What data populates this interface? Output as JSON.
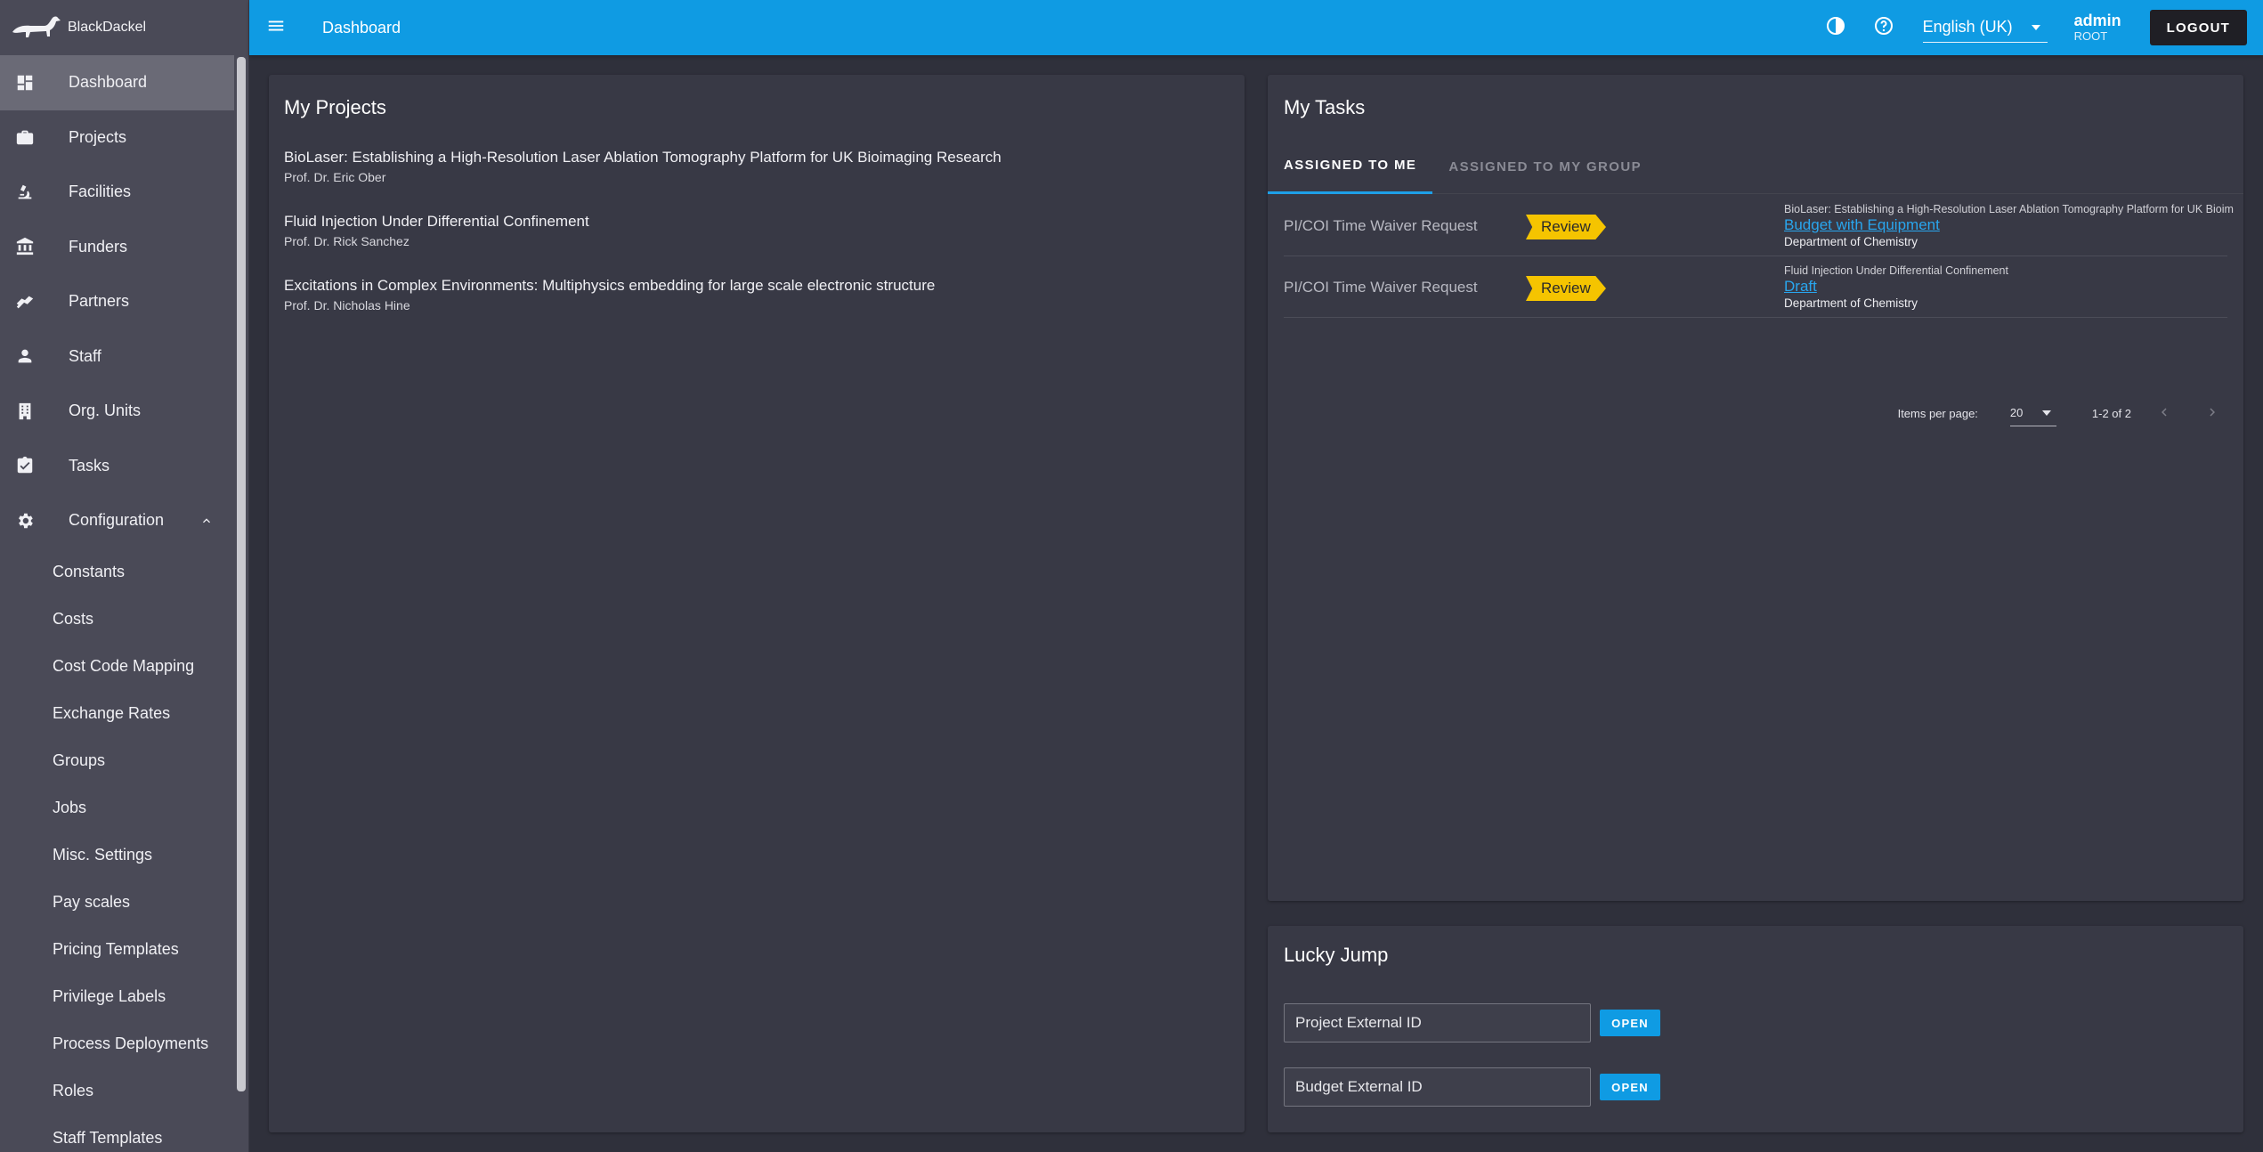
{
  "app": {
    "name": "BlackDackel"
  },
  "topbar": {
    "title": "Dashboard",
    "language": "English (UK)",
    "user_name": "admin",
    "user_role": "ROOT",
    "logout_label": "LOGOUT"
  },
  "sidebar": {
    "items": [
      {
        "label": "Dashboard",
        "icon": "dashboard-icon"
      },
      {
        "label": "Projects",
        "icon": "briefcase-icon"
      },
      {
        "label": "Facilities",
        "icon": "microscope-icon"
      },
      {
        "label": "Funders",
        "icon": "bank-icon"
      },
      {
        "label": "Partners",
        "icon": "handshake-icon"
      },
      {
        "label": "Staff",
        "icon": "person-icon"
      },
      {
        "label": "Org. Units",
        "icon": "building-icon"
      },
      {
        "label": "Tasks",
        "icon": "clipboard-check-icon"
      },
      {
        "label": "Configuration",
        "icon": "gear-icon"
      }
    ],
    "config_items": [
      "Constants",
      "Costs",
      "Cost Code Mapping",
      "Exchange Rates",
      "Groups",
      "Jobs",
      "Misc. Settings",
      "Pay scales",
      "Pricing Templates",
      "Privilege Labels",
      "Process Deployments",
      "Roles",
      "Staff Templates"
    ]
  },
  "projects": {
    "title": "My Projects",
    "items": [
      {
        "title": "BioLaser: Establishing a High-Resolution Laser Ablation Tomography Platform for UK Bioimaging Research",
        "pi": "Prof. Dr. Eric Ober"
      },
      {
        "title": "Fluid Injection Under Differential Confinement",
        "pi": "Prof. Dr. Rick Sanchez"
      },
      {
        "title": "Excitations in Complex Environments: Multiphysics embedding for large scale electronic structure",
        "pi": "Prof. Dr. Nicholas Hine"
      }
    ]
  },
  "tasks": {
    "title": "My Tasks",
    "tabs": [
      "ASSIGNED TO ME",
      "ASSIGNED TO MY GROUP"
    ],
    "rows": [
      {
        "name": "PI/COI Time Waiver Request",
        "status": "Review",
        "project": "BioLaser: Establishing a High-Resolution Laser Ablation Tomography Platform for UK Bioim",
        "link": "Budget with Equipment",
        "department": "Department of Chemistry"
      },
      {
        "name": "PI/COI Time Waiver Request",
        "status": "Review",
        "project": "Fluid Injection Under Differential Confinement",
        "link": "Draft",
        "department": "Department of Chemistry"
      }
    ],
    "pager": {
      "label": "Items per page:",
      "size": "20",
      "range": "1-2 of 2"
    }
  },
  "lucky_jump": {
    "title": "Lucky Jump",
    "project_placeholder": "Project External ID",
    "budget_placeholder": "Budget External ID",
    "open_label": "OPEN"
  },
  "colors": {
    "primary": "#0f9be3",
    "badge": "#f5c400",
    "sidebar": "#4a4a57",
    "card": "#383945"
  }
}
